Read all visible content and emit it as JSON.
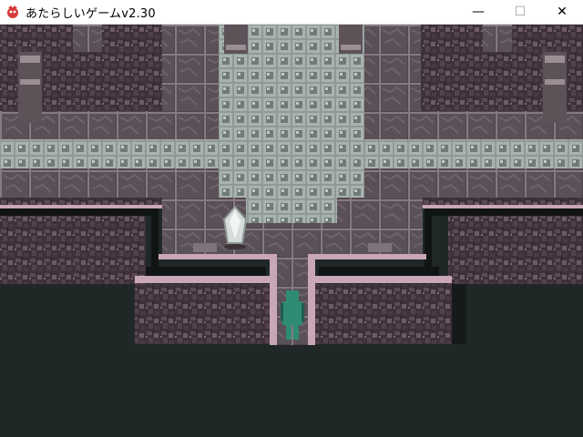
{
  "window": {
    "title": "あたらしいゲームv2.30",
    "controls": {
      "minimize": "—",
      "maximize": "☐",
      "close": "✕"
    }
  },
  "colors": {
    "void": "#1f2827",
    "wall_dark": "#3a2e35",
    "wall_mid": "#5a4852",
    "wall_light": "#7e6a74",
    "edge_pink": "#c9a7b6",
    "tile_dark": "#4d434b",
    "tile_light": "#a9b0ae",
    "character": "#2e8b74"
  },
  "scene": {
    "character": "player",
    "objects": [
      "crystal",
      "pillar",
      "pillar",
      "pillar",
      "pillar",
      "stone-plaque"
    ]
  }
}
